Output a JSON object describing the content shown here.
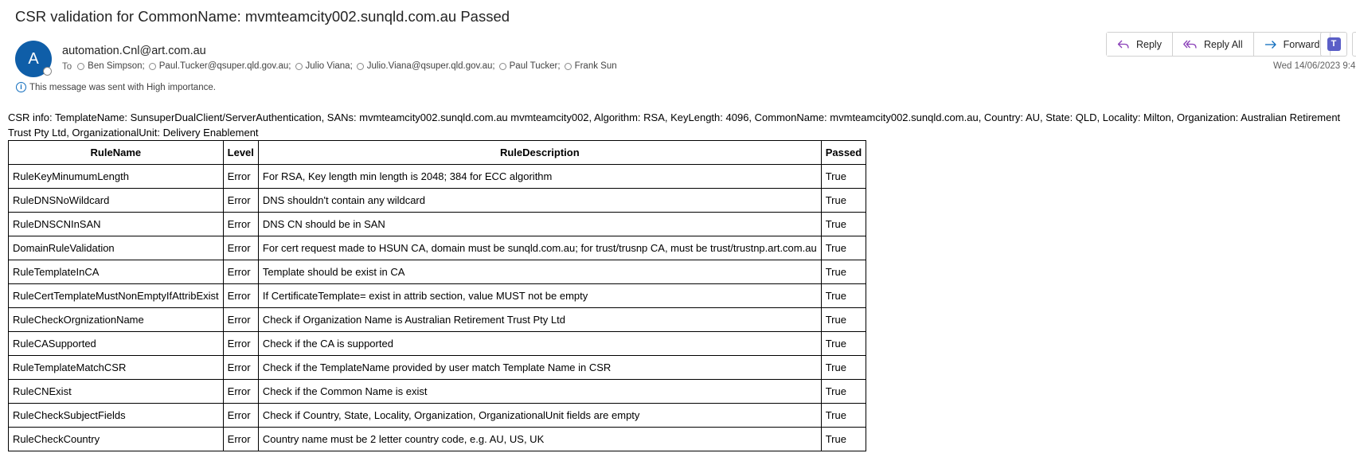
{
  "email": {
    "subject": "CSR validation for CommonName: mvmteamcity002.sunqld.com.au Passed",
    "sender_initial": "A",
    "sender": "automation.Cnl@art.com.au",
    "to_label": "To",
    "recipients": [
      "Ben Simpson;",
      "Paul.Tucker@qsuper.qld.gov.au;",
      "Julio Viana;",
      "Julio.Viana@qsuper.qld.gov.au;",
      "Paul Tucker;",
      "Frank Sun"
    ],
    "importance_note": "This message was sent with High importance.",
    "timestamp": "Wed 14/06/2023 9:4",
    "actions": {
      "reply": "Reply",
      "reply_all": "Reply All",
      "forward": "Forward"
    },
    "icons": {
      "reply": "reply-icon",
      "reply_all": "reply-all-icon",
      "forward": "forward-icon",
      "teams": "teams-icon",
      "info": "info-icon"
    },
    "colors": {
      "accent": "#0f6cbd",
      "avatar": "#0f5ea8",
      "reply_icon": "#8a3fb8",
      "teams": "#5b5fc7"
    }
  },
  "body": {
    "csr_info": "CSR info: TemplateName: SunsuperDualClient/ServerAuthentication, SANs: mvmteamcity002.sunqld.com.au mvmteamcity002, Algorithm: RSA, KeyLength: 4096, CommonName: mvmteamcity002.sunqld.com.au, Country: AU, State: QLD, Locality: Milton, Organization: Australian Retirement Trust Pty Ltd, OrganizationalUnit: Delivery Enablement",
    "table": {
      "headers": [
        "RuleName",
        "Level",
        "RuleDescription",
        "Passed"
      ],
      "rows": [
        [
          "RuleKeyMinumumLength",
          "Error",
          "For RSA, Key length min length is 2048; 384 for ECC algorithm",
          "True"
        ],
        [
          "RuleDNSNoWildcard",
          "Error",
          "DNS shouldn't contain any wildcard",
          "True"
        ],
        [
          "RuleDNSCNInSAN",
          "Error",
          "DNS CN should be in SAN",
          "True"
        ],
        [
          "DomainRuleValidation",
          "Error",
          "For cert request made to HSUN CA, domain must be sunqld.com.au; for trust/trusnp CA, must be trust/trustnp.art.com.au",
          "True"
        ],
        [
          "RuleTemplateInCA",
          "Error",
          "Template should be exist in CA",
          "True"
        ],
        [
          "RuleCertTemplateMustNonEmptyIfAttribExist",
          "Error",
          "If CertificateTemplate= exist in attrib section, value MUST not be empty",
          "True"
        ],
        [
          "RuleCheckOrgnizationName",
          "Error",
          "Check if Organization Name is Australian Retirement Trust Pty Ltd",
          "True"
        ],
        [
          "RuleCASupported",
          "Error",
          "Check if the CA is supported",
          "True"
        ],
        [
          "RuleTemplateMatchCSR",
          "Error",
          "Check if the TemplateName provided by user match Template Name in CSR",
          "True"
        ],
        [
          "RuleCNExist",
          "Error",
          "Check if the Common Name is exist",
          "True"
        ],
        [
          "RuleCheckSubjectFields",
          "Error",
          "Check if Country, State, Locality, Organization, OrganizationalUnit fields are empty",
          "True"
        ],
        [
          "RuleCheckCountry",
          "Error",
          "Country name must be 2 letter country code, e.g. AU, US, UK",
          "True"
        ]
      ]
    }
  }
}
